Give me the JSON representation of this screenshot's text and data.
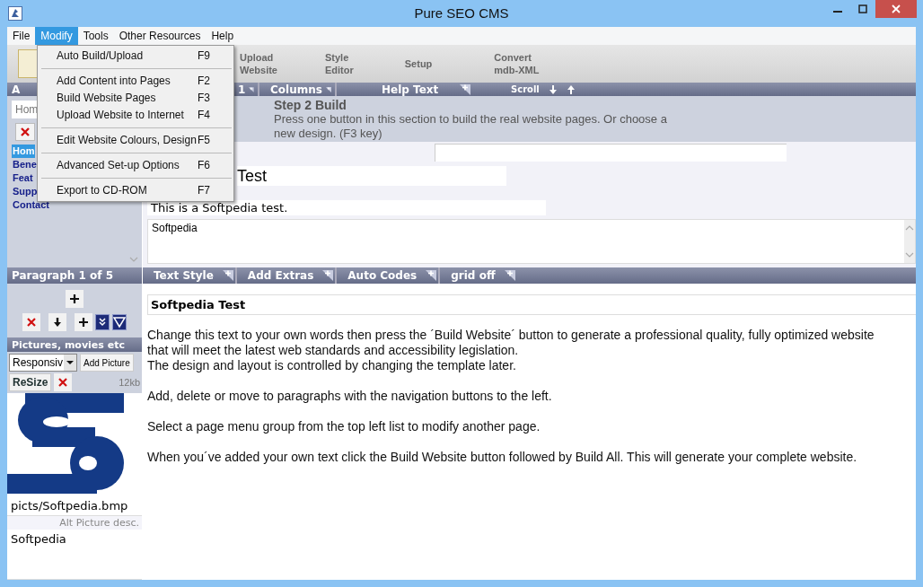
{
  "window": {
    "title": "Pure SEO CMS"
  },
  "menu_bar": [
    {
      "label": "File",
      "selected": false
    },
    {
      "label": "Modify",
      "selected": true
    },
    {
      "label": "Tools",
      "selected": false
    },
    {
      "label": "Other Resources",
      "selected": false
    },
    {
      "label": "Help",
      "selected": false
    }
  ],
  "open_menu": [
    {
      "label": "Auto Build/Upload",
      "shortcut": "F9",
      "separator_after": true
    },
    {
      "label": "Add Content into Pages",
      "shortcut": "F2",
      "separator_after": false
    },
    {
      "label": "Build Website Pages",
      "shortcut": "F3",
      "separator_after": false
    },
    {
      "label": "Upload Website to Internet",
      "shortcut": "F4",
      "separator_after": true
    },
    {
      "label": "Edit Website Colours, Design",
      "shortcut": "F5",
      "separator_after": true
    },
    {
      "label": "Advanced Set-up Options",
      "shortcut": "F6",
      "separator_after": true
    },
    {
      "label": "Export to CD-ROM",
      "shortcut": "F7",
      "separator_after": false
    }
  ],
  "toolbar": [
    {
      "label": "Upload\nWebsite"
    },
    {
      "label": "Style\nEditor"
    },
    {
      "label": "Setup"
    },
    {
      "label": "Convert\nmdb-XML"
    }
  ],
  "left_panel": {
    "header": "A",
    "page_field": "Hom",
    "pages": [
      {
        "label": "Hom",
        "selected": true
      },
      {
        "label": "Bene",
        "selected": false
      },
      {
        "label": "Feat",
        "selected": false
      },
      {
        "label": "Supp",
        "selected": false
      },
      {
        "label": "Contact",
        "selected": false
      }
    ]
  },
  "paragraph_panel": {
    "header": "Paragraph 1 of 5"
  },
  "pictures_panel": {
    "header": "Pictures, movies etc",
    "layout_select": "Responsiv",
    "add_button": "Add Picture",
    "resize_button": "ReSize",
    "size": "12kb",
    "path": "picts/Softpedia.bmp",
    "alt_label": "Alt Picture desc.",
    "alt_value": "Softpedia"
  },
  "top_tabs": [
    {
      "label": "1",
      "kind": "plus"
    },
    {
      "label": "Columns",
      "kind": "plus"
    },
    {
      "label": "Help Text",
      "kind": "plus"
    },
    {
      "label": "Scroll",
      "kind": "arrows"
    }
  ],
  "help": {
    "title": "Step 2 Build",
    "text": "Press one button in this section to build the real website pages. Or choose a\nnew design. (F3 key)"
  },
  "page_editor": {
    "heading": "Test",
    "subtitle": "This is a Softpedia test.",
    "keywords": "Softpedia"
  },
  "bottom_tabs": [
    {
      "label": "Text Style"
    },
    {
      "label": "Add Extras"
    },
    {
      "label": "Auto Codes"
    },
    {
      "label": "grid off"
    }
  ],
  "paragraph": {
    "title": "Softpedia Test",
    "blocks": [
      "Change this text to your own words then press the ´Build Website´ button to generate a professional quality,  fully optimized website\nthat will meet the latest web standards and accessibility legislation.\nThe design and layout is controlled by changing the template later.",
      "Add, delete or move to paragraphs with the navigation buttons to the left.",
      "Select a page menu group from the top left list to modify another page.",
      "When you´ve added your own text click the Build Website button followed by Build All. This will generate your complete website."
    ]
  }
}
